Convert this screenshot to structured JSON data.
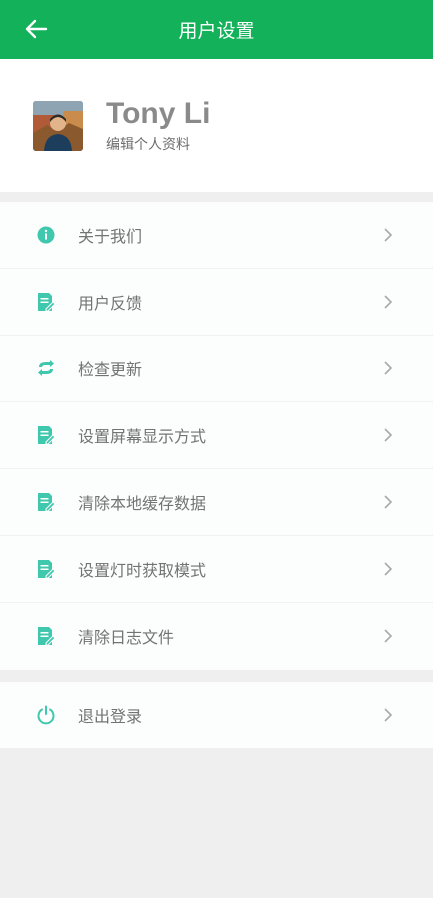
{
  "header": {
    "title": "用户设置",
    "back_icon": "arrow-left-icon"
  },
  "profile": {
    "name": "Tony Li",
    "edit_label": "编辑个人资料"
  },
  "menu": [
    {
      "label": "关于我们",
      "icon": "info-icon"
    },
    {
      "label": "用户反馈",
      "icon": "document-edit-icon"
    },
    {
      "label": "检查更新",
      "icon": "refresh-icon"
    },
    {
      "label": "设置屏幕显示方式",
      "icon": "document-edit-icon"
    },
    {
      "label": "清除本地缓存数据",
      "icon": "document-edit-icon"
    },
    {
      "label": "设置灯时获取模式",
      "icon": "document-edit-icon"
    },
    {
      "label": "清除日志文件",
      "icon": "document-edit-icon"
    }
  ],
  "logout": {
    "label": "退出登录",
    "icon": "power-icon"
  },
  "colors": {
    "brand": "#12b15a",
    "icon": "#3fc8ad"
  }
}
